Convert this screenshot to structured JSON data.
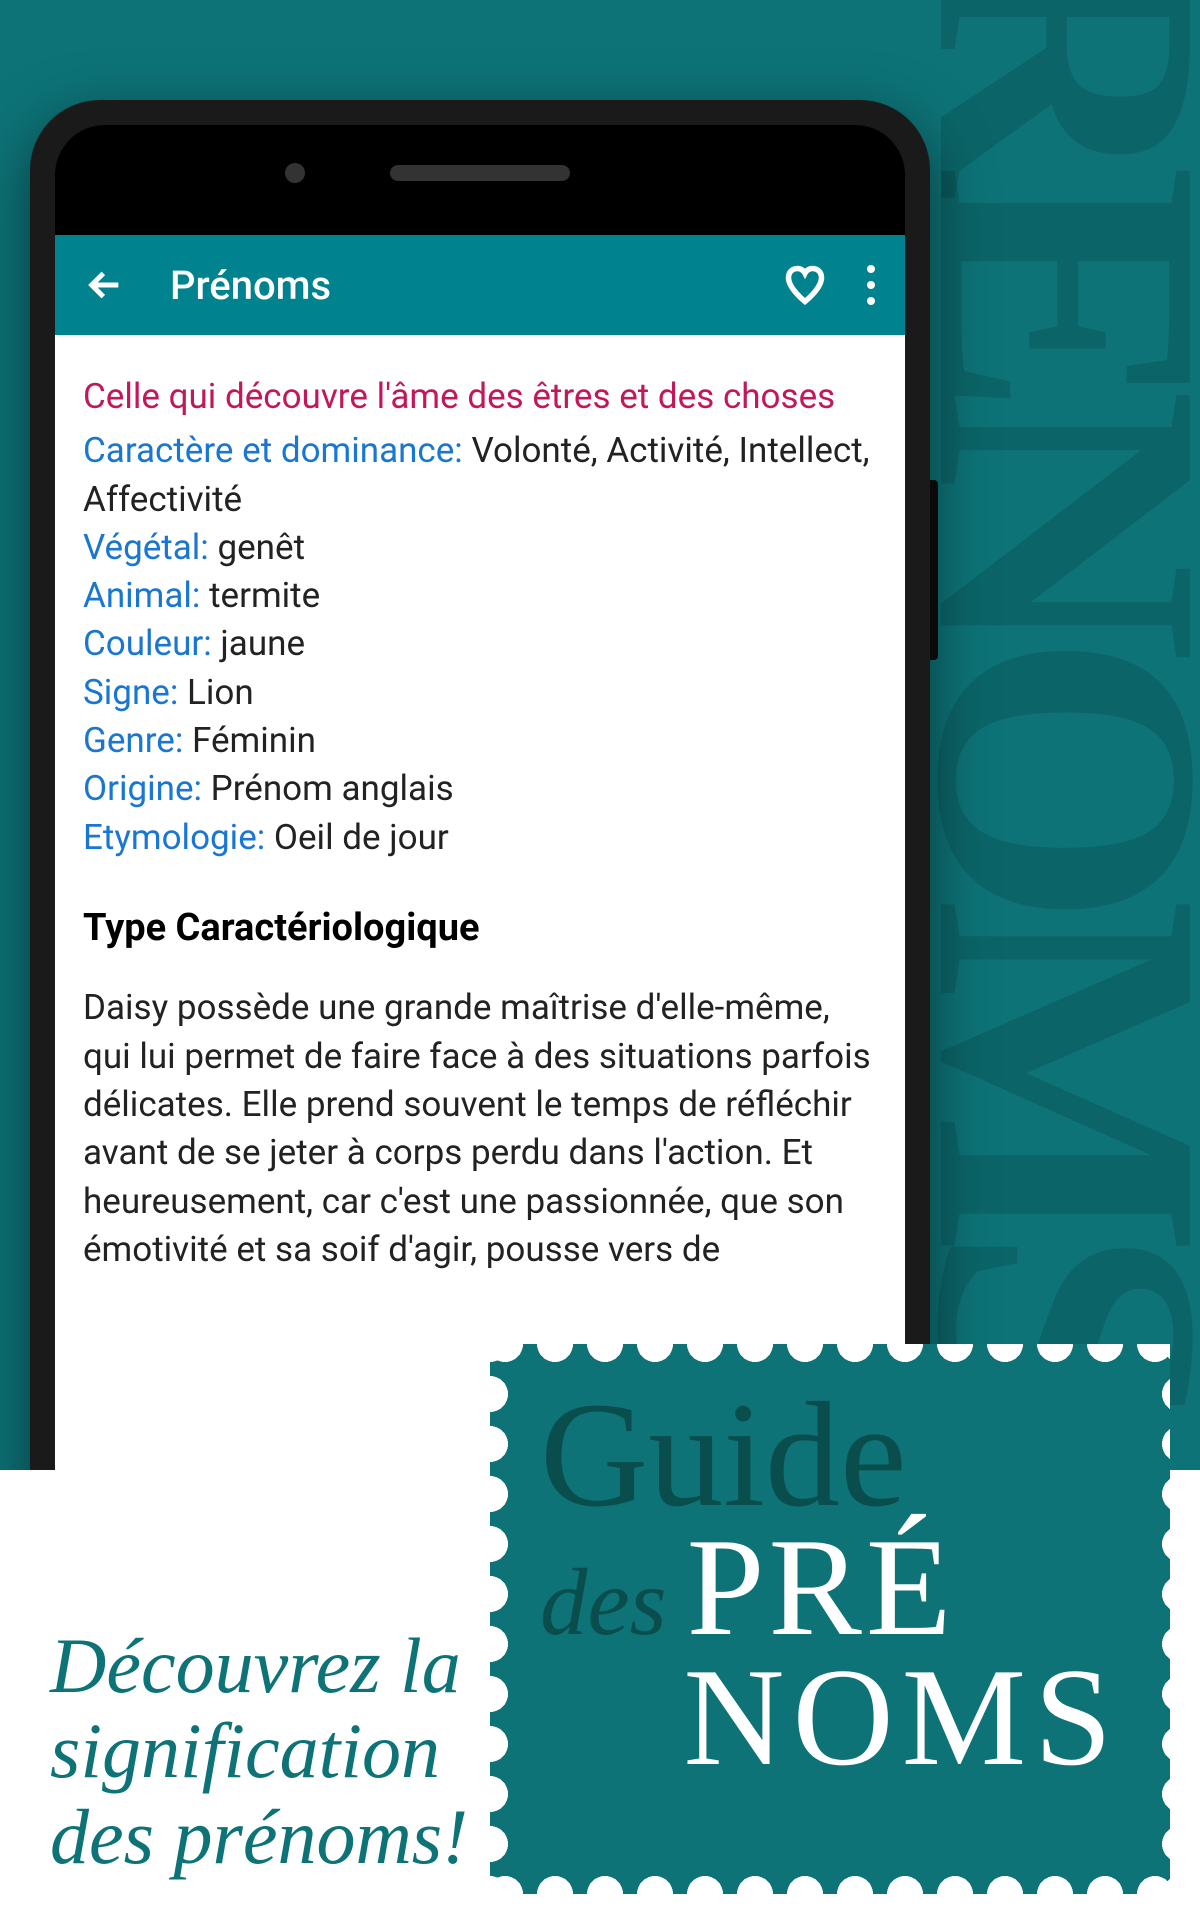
{
  "background_text": "RENOMS",
  "app": {
    "title": "Prénoms",
    "tagline": "Celle qui découvre l'âme des êtres et des choses",
    "attributes": [
      {
        "label": "Caractère et dominance:",
        "value": " Volonté, Activité, Intellect, Affectivité"
      },
      {
        "label": "Végétal:",
        "value": " genêt"
      },
      {
        "label": "Animal:",
        "value": " termite"
      },
      {
        "label": "Couleur:",
        "value": " jaune"
      },
      {
        "label": "Signe:",
        "value": " Lion"
      },
      {
        "label": "Genre:",
        "value": " Féminin"
      },
      {
        "label": "Origine:",
        "value": " Prénom anglais"
      },
      {
        "label": "Etymologie:",
        "value": " Oeil de jour"
      }
    ],
    "section_title": "Type Caractériologique",
    "description": "Daisy possède une grande maîtrise d'elle-même, qui lui permet de faire face à des situations parfois délicates. Elle prend souvent le temps de réfléchir avant de se jeter à corps perdu dans l'action. Et heureusement, car c'est une passionnée, que son émotivité et sa soif d'agir, pousse vers de"
  },
  "promo": {
    "tagline_line1": "Découvrez la",
    "tagline_line2": "signification",
    "tagline_line3": "des prénoms!",
    "stamp_guide": "Guide",
    "stamp_des": "des",
    "stamp_pre": "PRÉ",
    "stamp_noms": "NOMS"
  }
}
